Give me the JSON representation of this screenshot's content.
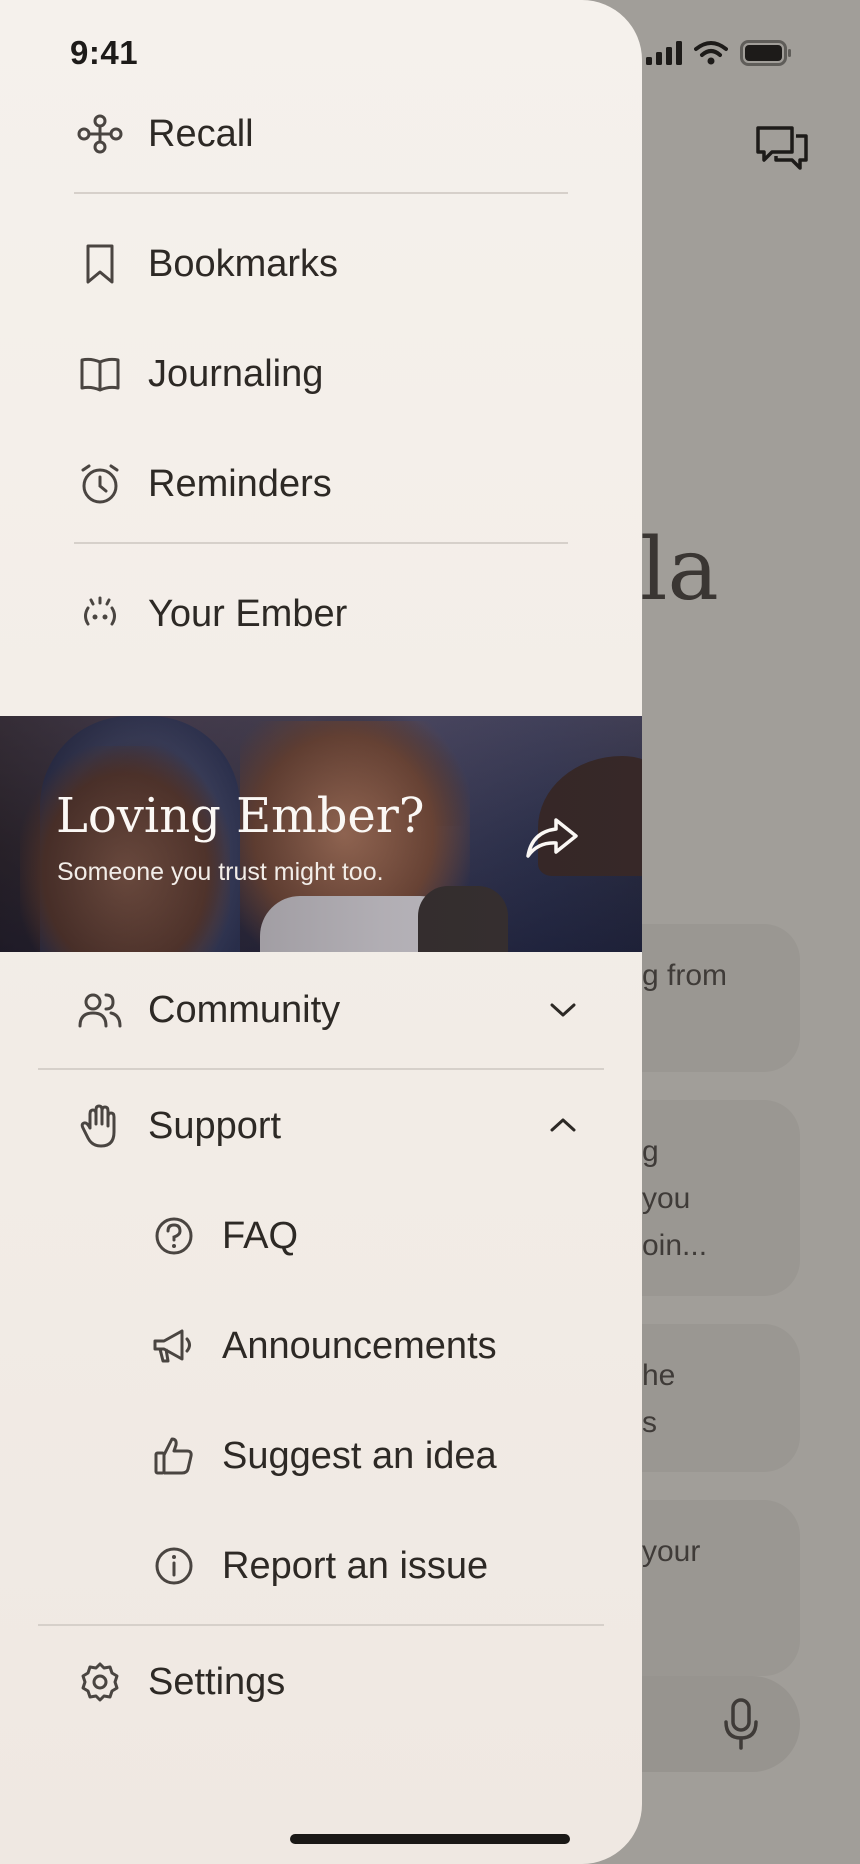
{
  "status_bar": {
    "time": "9:41"
  },
  "background": {
    "greeting_fragment": "la",
    "cards": [
      {
        "lines": [
          "g from"
        ]
      },
      {
        "lines": [
          "g",
          "you",
          "oin..."
        ]
      },
      {
        "lines": [
          "he",
          "s"
        ]
      },
      {
        "lines": [
          "your"
        ]
      }
    ]
  },
  "drawer": {
    "items_top": [
      {
        "label": "Recall",
        "icon": "recall-icon"
      },
      {
        "label": "Bookmarks",
        "icon": "bookmark-icon"
      },
      {
        "label": "Journaling",
        "icon": "book-icon"
      },
      {
        "label": "Reminders",
        "icon": "alarm-clock-icon"
      },
      {
        "label": "Your Ember",
        "icon": "ember-icon"
      }
    ],
    "promo": {
      "title": "Loving Ember?",
      "subtitle": "Someone you trust might too."
    },
    "community": {
      "label": "Community",
      "expanded": false
    },
    "support": {
      "label": "Support",
      "expanded": true,
      "items": [
        {
          "label": "FAQ",
          "icon": "question-icon"
        },
        {
          "label": "Announcements",
          "icon": "megaphone-icon"
        },
        {
          "label": "Suggest an idea",
          "icon": "thumbs-up-icon"
        },
        {
          "label": "Report an issue",
          "icon": "info-icon"
        }
      ]
    },
    "settings": {
      "label": "Settings",
      "icon": "gear-icon"
    }
  },
  "colors": {
    "drawer_bg": "#f5f1ec",
    "text": "#2d2925",
    "icon": "#4a4541",
    "overlay_bg": "#a19e99"
  }
}
